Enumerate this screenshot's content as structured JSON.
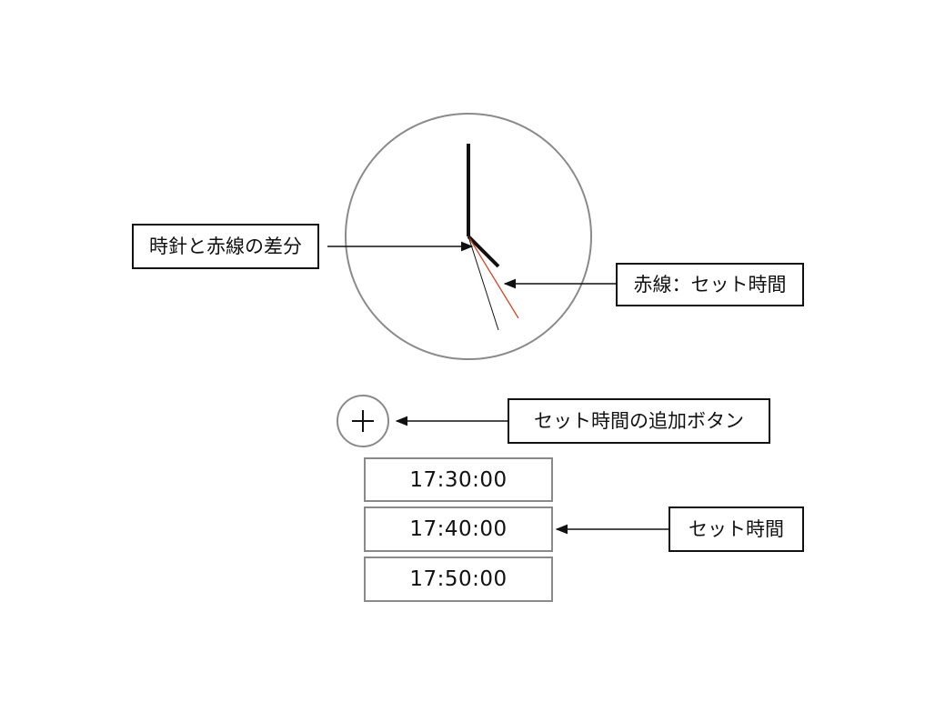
{
  "callouts": {
    "hand_diff": "時針と赤線の差分",
    "red_line": "赤線：セット時間",
    "add_button": "セット時間の追加ボタン",
    "set_time": "セット時間"
  },
  "add_button": {
    "icon": "plus-icon"
  },
  "set_times": [
    "17:30:00",
    "17:40:00",
    "17:50:00"
  ],
  "colors": {
    "hands": "#111111",
    "red_line": "#d8401f",
    "clock_outline": "#8a8a8a"
  }
}
